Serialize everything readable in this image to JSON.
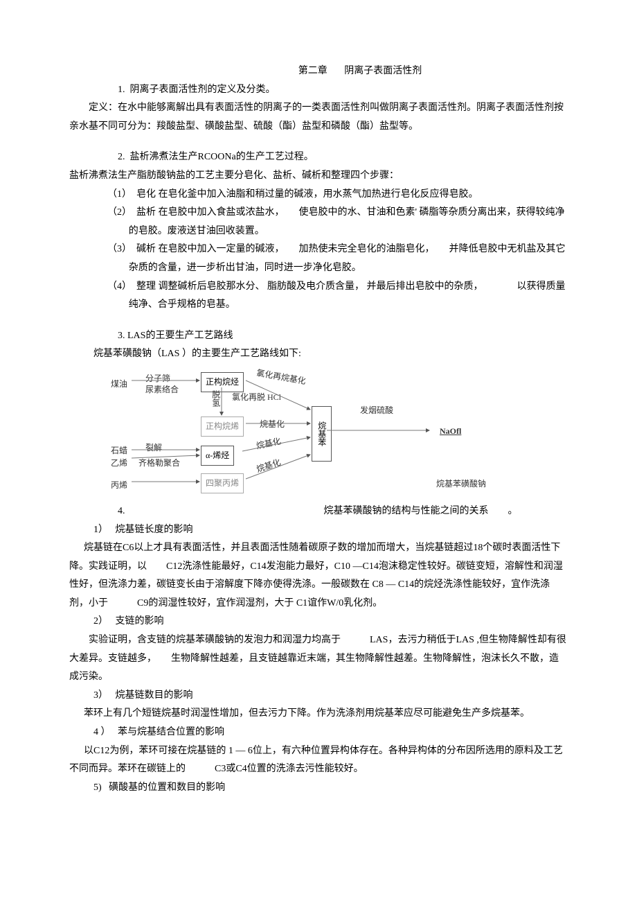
{
  "chapter": {
    "label": "第二章",
    "title": "阴离子表面活性剂"
  },
  "q1": {
    "num": "1.",
    "title": "阴离子表面活性剂的定义及分类。",
    "body": "定义：在水中能够离解出具有表面活性的阴离子的一类表面活性剂叫做阴离子表面活性剂。阴离子表面活性剂按亲水基不同可分为：羧酸盐型、磺酸盐型、硫酸（酯）盐型和磷酸（酯）盐型等。"
  },
  "q2": {
    "num": "2.",
    "title": "盐析沸煮法生产RCOONa的生产工艺过程。",
    "intro": "盐析沸煮法生产脂肪酸钠盐的工艺主要分皂化、盐析、碱析和整理四个步骤：",
    "step1": "（1）　皂化 在皂化釜中加入油脂和稍过量的碱液，用水蒸气加热进行皂化反应得皂胶。",
    "step2": "（2）　盐析 在皂胶中加入食盐或浓盐水，　　使皂胶中的水、甘油和色素'  磷脂等杂质分离出来，获得较纯净的皂胶。废液送甘油回收装置。",
    "step3": "（3）　碱析 在皂胶中加入一定量的碱液，　　加热使未完全皂化的油脂皂化，　　并降低皂胶中无机盐及其它杂质的含量，进一步析出甘油，同时进一步净化皂胶。",
    "step4": "（4）　整理 调整碱析后皂胶那水分、 脂肪酸及电介质含量，  并最后排出皂胶中的杂质，　　　　以获得质量纯净、合乎规格的皂基。"
  },
  "q3": {
    "num": "3.",
    "title": "LAS的王要生产工艺路线",
    "intro": "烷基苯磺酸钠（LAS ）的主要生产工艺路线如下:"
  },
  "diagram": {
    "meiyou": "煤油",
    "fenziShai": "分子筛",
    "niaoSuLuoHe": "尿素络合",
    "zhengGouWanJing": "正构烷烃",
    "lvHuaZaiWanJiHua": "氯化再烷基化",
    "tuoQing": "脱氢",
    "lvHuaZaiTuoHCl": "氯化再脱 HCl",
    "zhengGouWanXi": "正构烷烯",
    "wanJiHua": "烷基化",
    "wanJiBen": "烷基苯",
    "faYanLiuSuan": "发烟硫酸",
    "NaOfl": "NaOfl",
    "shiLa": "石蜡",
    "yiXi": "乙烯",
    "lieJie": "裂解",
    "qiGeLePolymer": "齐格勒聚合",
    "alphaXiTing": "α-烯烃",
    "wanJiHua2": "烷基化",
    "wanJiHua3": "烷基化",
    "bingXi": "丙烯",
    "siJuBingXi": "四聚丙烯",
    "wanJiBenHuangSuanNa": "烷基苯磺酸钠"
  },
  "q4": {
    "num": "4.",
    "title": "烷基苯磺酸钠的结构与性能之间的关系　　。",
    "s1num": "1）",
    "s1title": "烷基链长度的影响",
    "s1body1": "烷基链在C6以上才具有表面活性，并且表面活性随着碳原子数的增加而增大，当烷基链超过18个碳时表面活性下降。实践证明，以　　C12洗涤性能最好，C14发泡能力最好，C10 —C14泡沫稳定性较好。碳链变短，溶解性和润湿性好，但洗涤力差，碳链变长由于溶解度下降亦使得洗涤。一般碳数在  C8 —  C14的烷烃洗涤性能较好，宜作洗涤剂，小于　　　C9的润湿性较好，宜作润湿剂，大于  C1谊作W/0乳化剂。",
    "s2num": "2）",
    "s2title": "支链的影响",
    "s2body": "实验证明，含支链的烷基苯磺酸钠的发泡力和润湿力均高于　　　LAS，去污力稍低于LAS  ,但生物降解性却有很大差异。支链越多，　　生物降解性越差，且支链越靠近末端，其生物降解性越差。生物降解性，泡沫长久不散，造成污染。",
    "s3num": "3）",
    "s3title": "烷基链数目的影响",
    "s3body": "苯环上有几个短链烷基时润湿性增加，但去污力下降。作为洗涤剂用烷基苯应尽可能避免生产多烷基苯。",
    "s4num": "4 ）",
    "s4title": "苯与烷基结合位置的影响",
    "s4body": "以C12为例，苯环可接在烷基链的  1 —  6位上，有六种位置异构体存在。各种异构体的分布因所选用的原料及工艺不同而异。苯环在碳链上的　　　C3或C4位置的洗涤去污性能较好。",
    "s5num": "5)",
    "s5title": "磺酸基的位置和数目的影响"
  }
}
